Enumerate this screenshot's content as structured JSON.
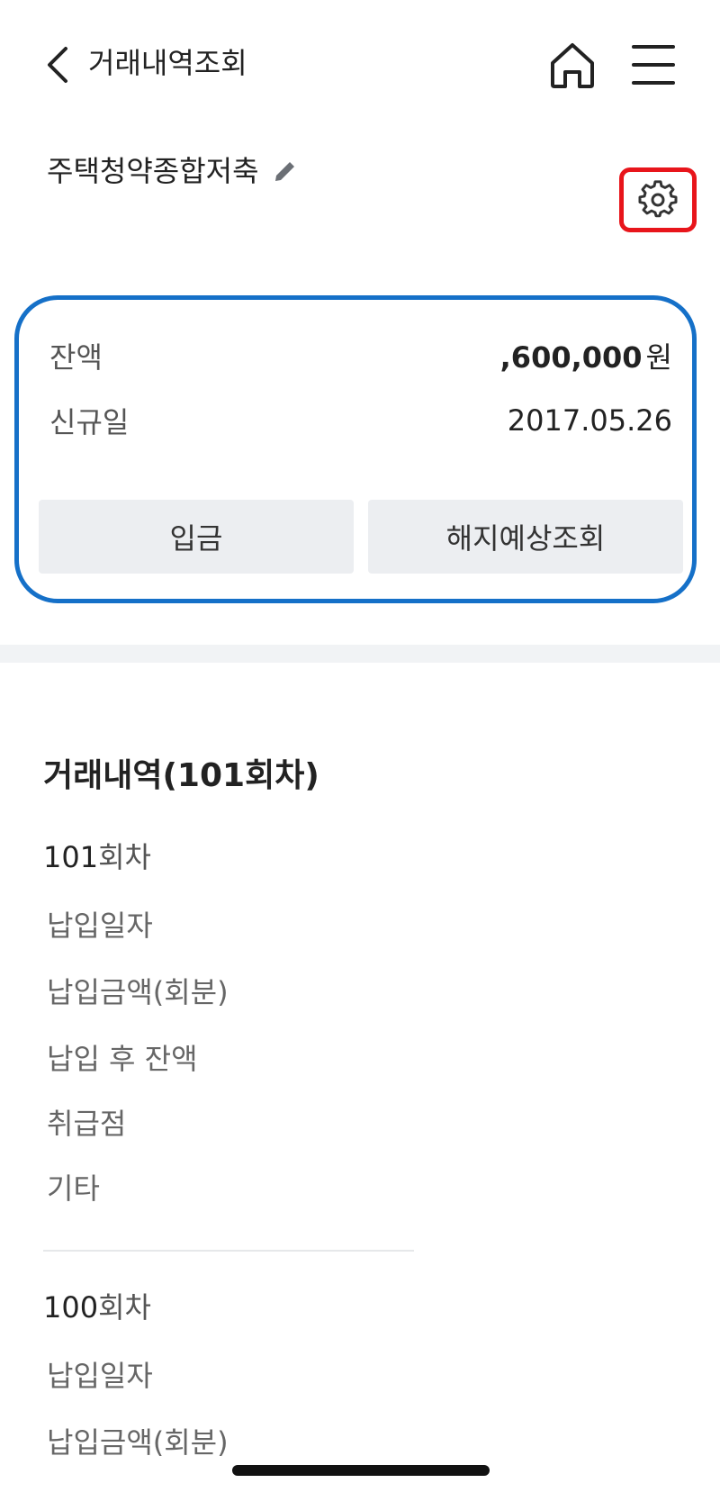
{
  "header": {
    "title": "거래내역조회",
    "back_icon": "chevron-left-icon",
    "home_icon": "home-icon",
    "menu_icon": "hamburger-menu-icon"
  },
  "account": {
    "name": "주택청약종합저축",
    "edit_icon": "pencil-icon",
    "settings_icon": "gear-icon",
    "balance_label": "잔액",
    "balance_value": ",600,000",
    "balance_unit": "원",
    "open_date_label": "신규일",
    "open_date_value": "2017.05.26",
    "deposit_button": "입금",
    "cancel_estimate_button": "해지예상조회"
  },
  "history": {
    "title": "거래내역(101회차)",
    "rounds": [
      {
        "number": "101",
        "suffix": "회차",
        "fields": [
          "납입일자",
          "납입금액(회분)",
          "납입 후 잔액",
          "취급점",
          "기타"
        ]
      },
      {
        "number": "100",
        "suffix": "회차",
        "fields": [
          "납입일자",
          "납입금액(회분)"
        ]
      }
    ]
  },
  "colors": {
    "highlight_red": "#e8151b",
    "highlight_blue": "#1570c8",
    "button_bg": "#eceef1"
  }
}
